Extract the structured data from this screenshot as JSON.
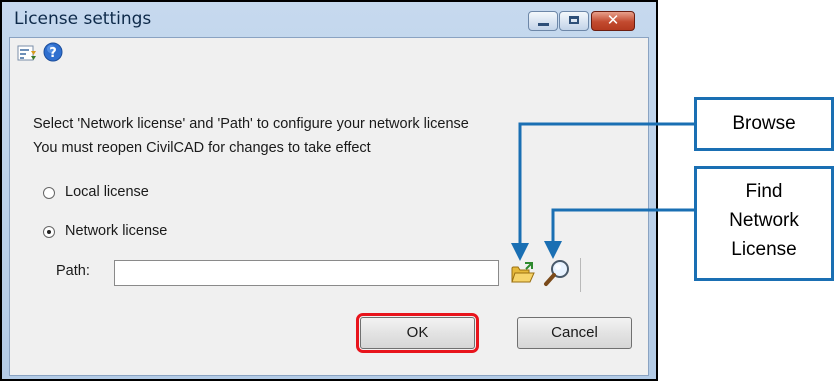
{
  "window": {
    "title": "License settings",
    "title_buttons": [
      "minimize",
      "maximize",
      "close"
    ]
  },
  "toolbar": {
    "icons": [
      "sort-icon",
      "help-icon"
    ]
  },
  "description": {
    "line1": "Select 'Network license' and 'Path' to configure your network license",
    "line2": "You must reopen CivilCAD for changes to take effect"
  },
  "options": {
    "local_label": "Local license",
    "network_label": "Network license",
    "selected": "network"
  },
  "path": {
    "label": "Path:",
    "value": "",
    "browse_icon": "folder-open-icon",
    "find_icon": "magnifier-icon"
  },
  "buttons": {
    "ok": "OK",
    "cancel": "Cancel"
  },
  "annotations": {
    "browse": "Browse",
    "find_line1": "Find",
    "find_line2": "Network",
    "find_line3": "License",
    "callout_color": "#1a6fb3",
    "highlight_color": "#e8141c"
  }
}
